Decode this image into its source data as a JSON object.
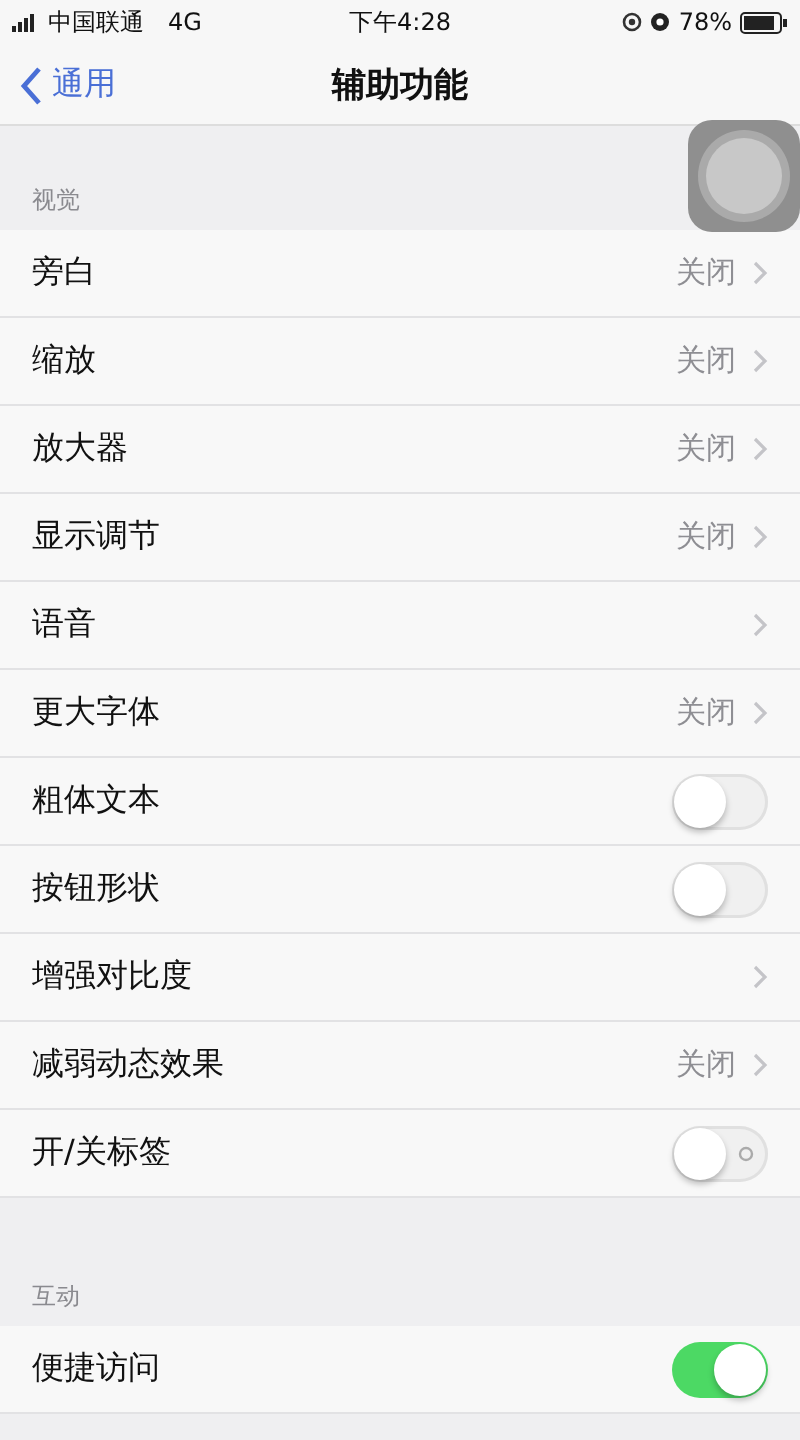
{
  "status_bar": {
    "carrier": "中国联通",
    "network": "4G",
    "time": "下午4:28",
    "battery": "78%"
  },
  "nav": {
    "back": "通用",
    "title": "辅助功能"
  },
  "sections": [
    {
      "header": "视觉",
      "rows": [
        {
          "kind": "link",
          "label": "旁白",
          "value": "关闭"
        },
        {
          "kind": "link",
          "label": "缩放",
          "value": "关闭"
        },
        {
          "kind": "link",
          "label": "放大器",
          "value": "关闭"
        },
        {
          "kind": "link",
          "label": "显示调节",
          "value": "关闭"
        },
        {
          "kind": "link",
          "label": "语音"
        },
        {
          "kind": "link",
          "label": "更大字体",
          "value": "关闭"
        },
        {
          "kind": "toggle",
          "label": "粗体文本",
          "on": false
        },
        {
          "kind": "toggle",
          "label": "按钮形状",
          "on": false
        },
        {
          "kind": "link",
          "label": "增强对比度"
        },
        {
          "kind": "link",
          "label": "减弱动态效果",
          "value": "关闭"
        },
        {
          "kind": "toggle",
          "label": "开/关标签",
          "on": false,
          "onoff_labels": true
        }
      ]
    },
    {
      "header": "互动",
      "rows": [
        {
          "kind": "toggle",
          "label": "便捷访问",
          "on": true
        }
      ]
    }
  ]
}
